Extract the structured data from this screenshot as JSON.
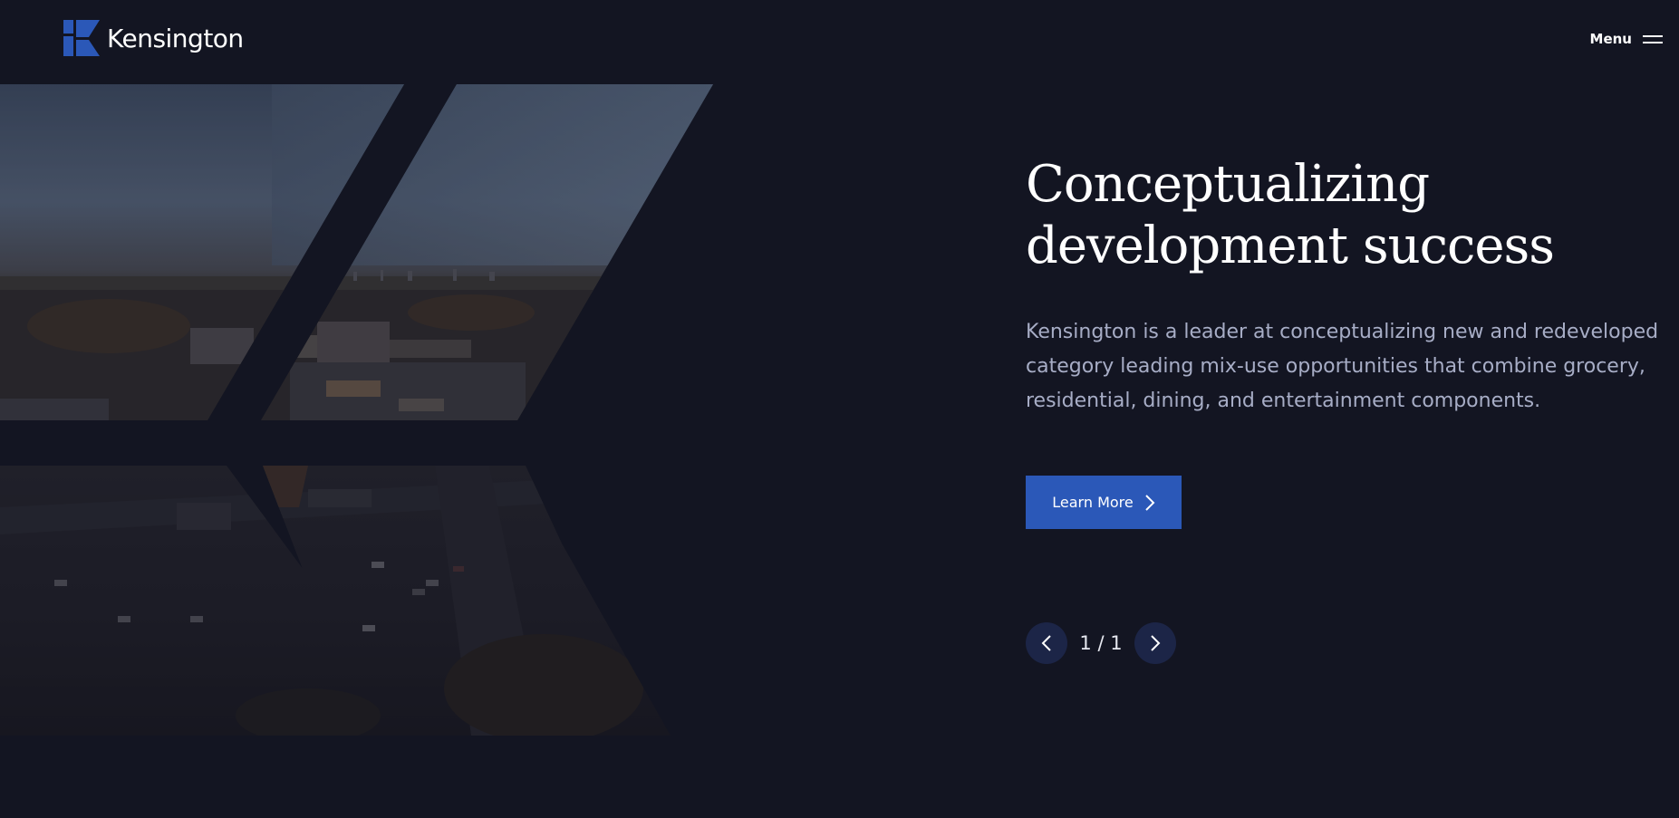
{
  "brand": {
    "name": "Kensington",
    "accent_color": "#2b58b8",
    "background_color": "#131522"
  },
  "header": {
    "menu_label": "Menu",
    "menu_icon": "hamburger-icon"
  },
  "hero": {
    "image_description_icon": "aerial-city-photo",
    "title_line1": "Conceptualizing",
    "title_line2": "development success",
    "description": "Kensington is a leader at conceptualizing new and redeveloped category leading mix-use opportunities that combine grocery, residential, dining, and entertainment components.",
    "cta_label": "Learn More",
    "cta_icon": "chevron-right-icon"
  },
  "slider": {
    "current": 1,
    "total": 1,
    "counter_text": "1 / 1",
    "prev_icon": "chevron-left-icon",
    "next_icon": "chevron-right-icon"
  }
}
